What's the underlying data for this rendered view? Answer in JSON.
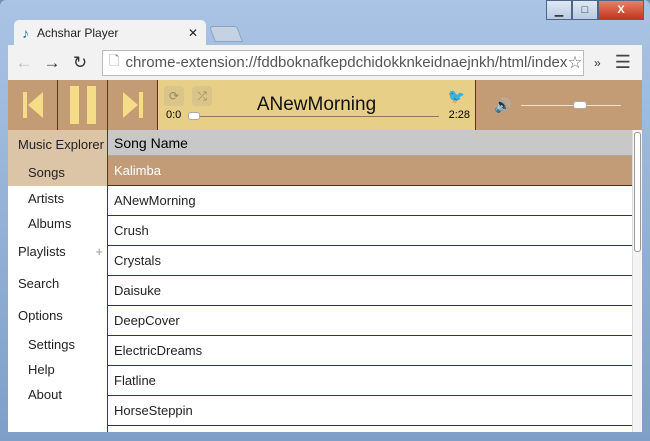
{
  "browser": {
    "tab_title": "Achshar Player",
    "url": "chrome-extension://fddboknafkepdchidokknkeidnaejnkh/html/index"
  },
  "player": {
    "track_title": "ANewMorning",
    "elapsed": "0:0",
    "duration": "2:28",
    "progress": 0,
    "volume": 0.6,
    "accent": "#c39c76"
  },
  "sidebar": {
    "music_explorer": "Music Explorer",
    "songs": "Songs",
    "artists": "Artists",
    "albums": "Albums",
    "playlists": "Playlists",
    "plus": "+",
    "search": "Search",
    "options": "Options",
    "settings": "Settings",
    "help": "Help",
    "about": "About"
  },
  "list": {
    "header": "Song Name",
    "songs": [
      "Kalimba",
      "ANewMorning",
      "Crush",
      "Crystals",
      "Daisuke",
      "DeepCover",
      "ElectricDreams",
      "Flatline",
      "HorseSteppin"
    ]
  }
}
